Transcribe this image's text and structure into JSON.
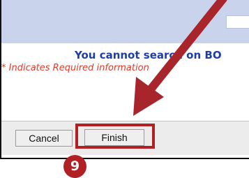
{
  "header": {
    "background_color": "#c9d4ec"
  },
  "messages": {
    "warning": "You cannot search on BO",
    "required_note": "* Indicates Required information",
    "warning_color": "#1d3ea8",
    "required_color": "#e0392b"
  },
  "buttons": {
    "cancel_label": "Cancel",
    "finish_label": "Finish"
  },
  "annotation": {
    "step_number": "9",
    "highlight_color": "#b02024",
    "arrow_icon": "red-pointer-arrow-icon"
  }
}
